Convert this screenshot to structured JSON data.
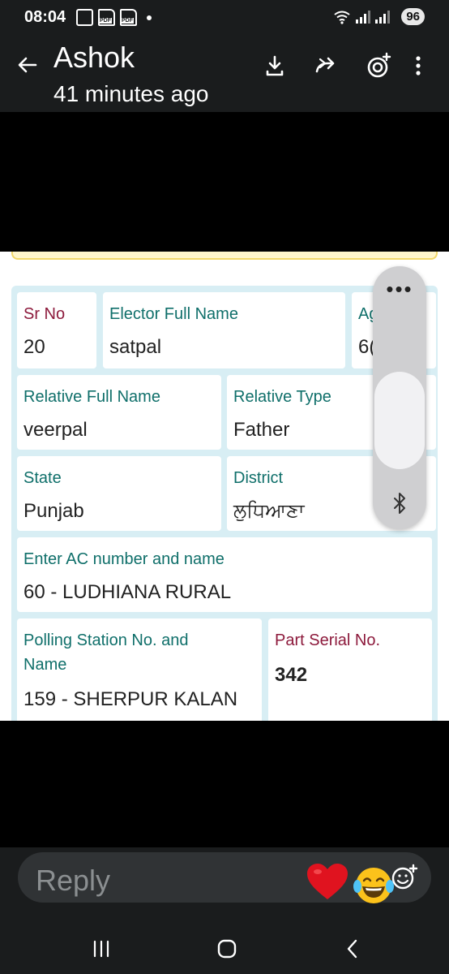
{
  "status_bar": {
    "time": "08:04",
    "battery": "96",
    "icons_left": [
      "screenshot-icon",
      "pdf-icon",
      "pdf-icon",
      "notification-dot"
    ],
    "icons_right": [
      "wifi-icon",
      "signal-icon",
      "signal-icon"
    ]
  },
  "header": {
    "contact_name": "Ashok",
    "subtitle": "41 minutes ago",
    "actions": [
      "download-icon",
      "forward-icon",
      "lens-icon",
      "more-icon"
    ]
  },
  "card": {
    "sr_no_label": "Sr No",
    "sr_no_value": "20",
    "elector_label": "Elector Full Name",
    "elector_value": "satpal",
    "age_label": "Ag",
    "age_value": "6(",
    "relative_name_label": "Relative Full Name",
    "relative_name_value": "veerpal",
    "relative_type_label": "Relative Type",
    "relative_type_value": "Father",
    "state_label": "State",
    "state_value": "Punjab",
    "district_label": "District",
    "district_value": "ਲੁਧਿਆਣਾ",
    "ac_label": "Enter AC number and name",
    "ac_value": "60 - LUDHIANA RURAL",
    "polling_label_line1": "Polling Station No. and",
    "polling_label_line2": "Name",
    "polling_value": "159 - SHERPUR KALAN",
    "part_serial_label": "Part Serial No.",
    "part_serial_value": "342"
  },
  "floating_panel": {
    "dots": "•••",
    "icon": "bluetooth-icon"
  },
  "reply": {
    "placeholder": "Reply",
    "quick_reactions": [
      "red-heart-emoji",
      "tears-of-joy-emoji"
    ],
    "picker_icon": "emoji-add-icon"
  },
  "nav": [
    "recents-icon",
    "home-icon",
    "back-icon"
  ],
  "colors": {
    "bar_bg": "#1a1c1d",
    "label_teal": "#0f6f6a",
    "label_maroon": "#8d1a3c",
    "card_border": "#d8eef4"
  }
}
